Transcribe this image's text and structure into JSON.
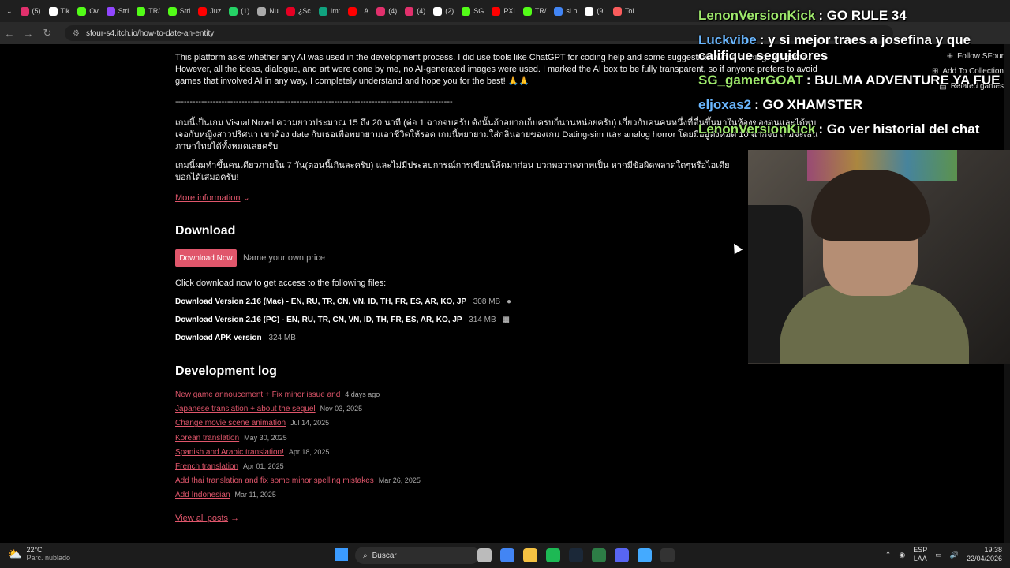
{
  "browser": {
    "tabs": [
      {
        "label": "(5)",
        "color": "#e1306c"
      },
      {
        "label": "Tik",
        "color": "#ffffff"
      },
      {
        "label": "Ov",
        "color": "#53fc18"
      },
      {
        "label": "Stri",
        "color": "#9146ff"
      },
      {
        "label": "TR/",
        "color": "#53fc18"
      },
      {
        "label": "Stri",
        "color": "#53fc18"
      },
      {
        "label": "Juz",
        "color": "#ff0000"
      },
      {
        "label": "(1)",
        "color": "#25d366"
      },
      {
        "label": "Nu",
        "color": "#aaaaaa"
      },
      {
        "label": "¿Sc",
        "color": "#e60023"
      },
      {
        "label": "Im:",
        "color": "#10a37f"
      },
      {
        "label": "LA",
        "color": "#ff0000"
      },
      {
        "label": "(4)",
        "color": "#e1306c"
      },
      {
        "label": "(4)",
        "color": "#e1306c"
      },
      {
        "label": "(2)",
        "color": "#ffffff"
      },
      {
        "label": "SG",
        "color": "#53fc18"
      },
      {
        "label": "PXI",
        "color": "#ff0000"
      },
      {
        "label": "TR/",
        "color": "#53fc18"
      },
      {
        "label": "si n",
        "color": "#4285f4"
      },
      {
        "label": "(9!",
        "color": "#ffffff"
      },
      {
        "label": "Toi",
        "color": "#fa5c5c"
      }
    ],
    "url": "sfour-s4.itch.io/how-to-date-an-entity"
  },
  "page": {
    "ai_notice": "This platform asks whether any AI was used in the development process. I did use tools like ChatGPT for coding help and some suggestions while making this game. However, all the ideas, dialogue, and art were done by me, no AI-generated images were used. I marked the AI box to be fully transparent, so if anyone prefers to avoid games that involved AI in any way, I completely understand and hope you for the best! 🙏🙏",
    "divider": "------------------------------------------------------------------------------------------------",
    "thai_1": "เกมนี้เป็นเกม Visual Novel ความยาวประมาณ 15 ถึง 20 นาที (ต่อ 1 ฉากจบครับ ดังนั้นถ้าอยากเก็บครบก็นานหน่อยครับ) เกี่ยวกับคนคนหนึ่งที่ตื่นขึ้นมาในห้องของตนและได้พบเจอกับหญิงสาวปริศนา เขาต้อง date กับเธอเพื่อพยายามเอาชีวิตให้รอด เกมนี้พยายามใส่กลิ่นอายของเกม Dating-sim และ analog horror โดยมีอยู่ทั้งหมด 10 ฉากจบ เกมจะเล่นภาษาไทยได้ทั้งหมดเลยครับ",
    "thai_2": "เกมนี้ผมทำขึ้นคนเดียวภายใน 7 วัน(ตอนนี้เกินละครับ) และไม่มีประสบการณ์การเขียนโค้ดมาก่อน บวกพอวาดภาพเป็น หากมีข้อผิดพลาดใดๆหรือไอเดียบอกได้เสมอครับ!",
    "more_info": "More information",
    "download_heading": "Download",
    "download_btn": "Download Now",
    "price_text": "Name your own price",
    "download_intro": "Click download now to get access to the following files:",
    "files": [
      {
        "name": "Download Version 2.16 (Mac) - EN, RU, TR, CN, VN, ID, TH, FR, ES, AR, KO, JP",
        "size": "308 MB",
        "platform": "apple-icon"
      },
      {
        "name": "Download Version 2.16 (PC) - EN, RU, TR, CN, VN, ID, TH, FR, ES, AR, KO, JP",
        "size": "314 MB",
        "platform": "windows-icon"
      },
      {
        "name": "Download APK version",
        "size": "324 MB",
        "platform": ""
      }
    ],
    "devlog_heading": "Development log",
    "devlog": [
      {
        "title": "New game annoucement + Fix minor issue and",
        "date": "4 days ago"
      },
      {
        "title": "Japanese translation + about the sequel",
        "date": "Nov 03, 2025"
      },
      {
        "title": "Change movie scene animation",
        "date": "Jul 14, 2025"
      },
      {
        "title": "Korean translation",
        "date": "May 30, 2025"
      },
      {
        "title": "Spanish and Arabic translation!",
        "date": "Apr 18, 2025"
      },
      {
        "title": "French translation",
        "date": "Apr 01, 2025"
      },
      {
        "title": "Add thai translation and fix some minor spelling mistakes",
        "date": "Mar 26, 2025"
      },
      {
        "title": "Add Indonesian",
        "date": "Mar 11, 2025"
      }
    ],
    "view_all": "View all posts",
    "side_buttons": {
      "follow": "Follow SFour",
      "add": "Add To Collection",
      "related": "Related games"
    }
  },
  "chat": [
    {
      "user": "LenonVersionKick",
      "msg": ": GO RULE 34",
      "color": "#9ee86b"
    },
    {
      "user": "Luckvibe",
      "msg": ": y si mejor traes a josefina y que califique seguidores",
      "color": "#6ab7ff"
    },
    {
      "user": "SG_gamerGOAT",
      "msg": ": BULMA ADVENTURE YA FUE",
      "color": "#9ee86b"
    },
    {
      "user": "eljoxas2",
      "msg": ": GO XHAMSTER",
      "color": "#6ab7ff"
    },
    {
      "user": "LenonVersionKick",
      "msg": ": Go ver historial del chat",
      "color": "#9ee86b"
    }
  ],
  "taskbar": {
    "temp": "22°C",
    "weather": "Parc. nublado",
    "search": "Buscar",
    "lang1": "ESP",
    "lang2": "LAA",
    "time": "19:38",
    "date": "22/04/2026"
  }
}
